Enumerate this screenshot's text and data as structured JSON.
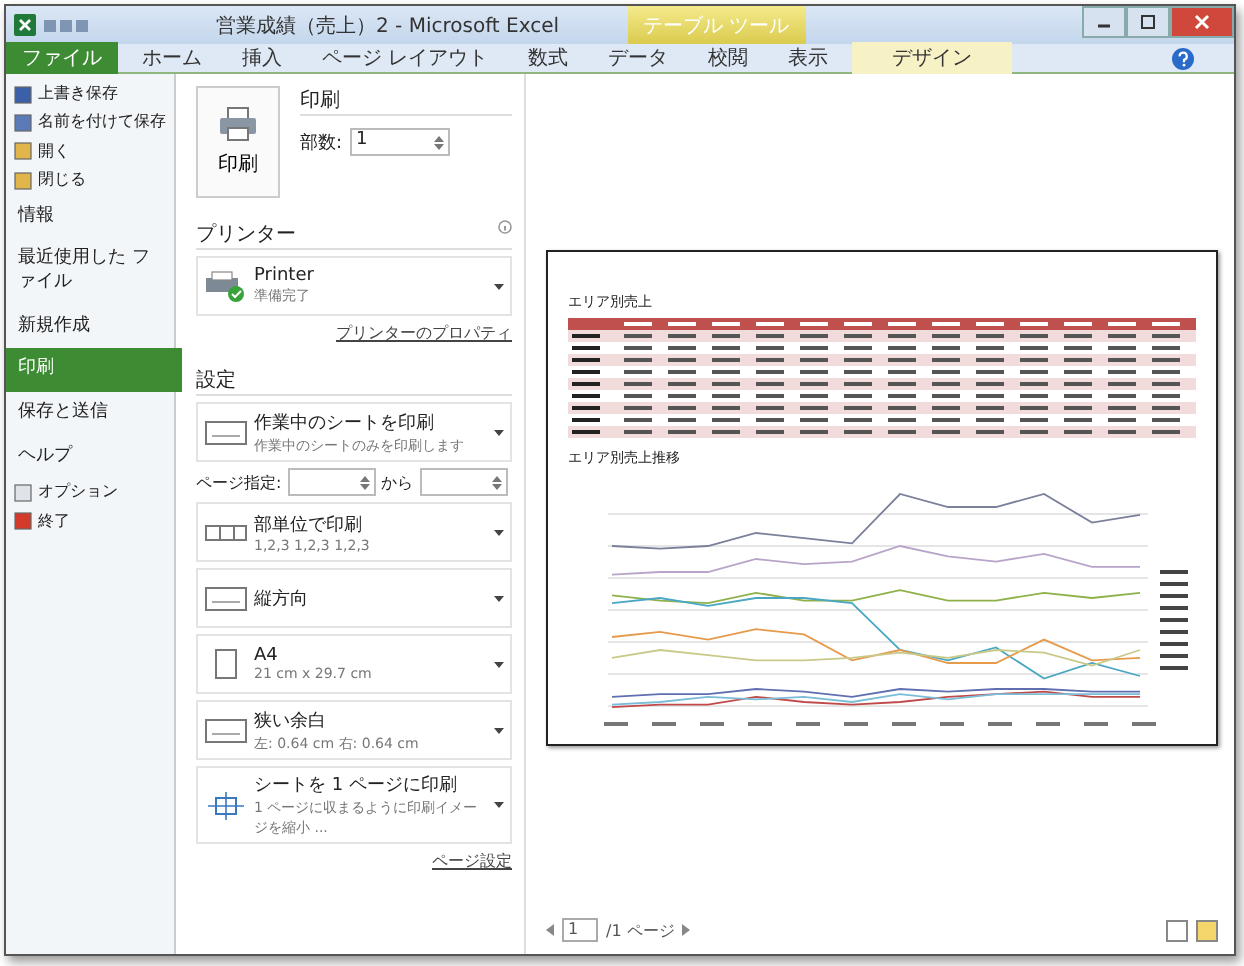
{
  "window": {
    "title": "営業成績（売上）2 - Microsoft Excel",
    "context_tab": "テーブル ツール"
  },
  "tabs": [
    {
      "label": "ファイル",
      "selected": true
    },
    {
      "label": "ホーム",
      "selected": false
    },
    {
      "label": "挿入",
      "selected": false
    },
    {
      "label": "ページ レイアウト",
      "selected": false
    },
    {
      "label": "数式",
      "selected": false
    },
    {
      "label": "データ",
      "selected": false
    },
    {
      "label": "校閲",
      "selected": false
    },
    {
      "label": "表示",
      "selected": false
    },
    {
      "label": "デザイン",
      "selected": false
    }
  ],
  "sidebar": {
    "items": [
      {
        "kind": "command",
        "label": "上書き保存",
        "selected": false
      },
      {
        "kind": "command",
        "label": "名前を付けて保存",
        "selected": false
      },
      {
        "kind": "command",
        "label": "開く",
        "selected": false
      },
      {
        "kind": "command",
        "label": "閉じる",
        "selected": false
      },
      {
        "kind": "section",
        "label": "情報",
        "selected": false
      },
      {
        "kind": "section",
        "label": "最近使用した ファイル",
        "selected": false
      },
      {
        "kind": "section",
        "label": "新規作成",
        "selected": false
      },
      {
        "kind": "section",
        "label": "印刷",
        "selected": true
      },
      {
        "kind": "section",
        "label": "保存と送信",
        "selected": false
      },
      {
        "kind": "section",
        "label": "ヘルプ",
        "selected": false
      },
      {
        "kind": "command",
        "label": "オプション",
        "selected": false
      },
      {
        "kind": "command",
        "label": "終了",
        "selected": false
      }
    ]
  },
  "print": {
    "button": "印刷",
    "heading": "印刷",
    "copies_label": "部数:",
    "copies": "1"
  },
  "printer": {
    "heading": "プリンター",
    "name": "Printer",
    "status": "準備完了",
    "properties_link": "プリンターのプロパティ"
  },
  "settings": {
    "heading": "設定",
    "options": [
      {
        "kind": "sheet",
        "title": "作業中のシートを印刷",
        "detail": "作業中のシートのみを印刷します"
      },
      {
        "kind": "pages",
        "from_label": "ページ指定:",
        "to_label": "から"
      },
      {
        "kind": "collate",
        "title": "部単位で印刷",
        "detail": "1,2,3    1,2,3    1,2,3"
      },
      {
        "kind": "orientation",
        "title": "縦方向"
      },
      {
        "kind": "paper",
        "title": "A4",
        "detail": "21 cm x 29.7 cm"
      },
      {
        "kind": "margins",
        "title": "狭い余白",
        "detail": "左: 0.64 cm   右: 0.64 cm"
      },
      {
        "kind": "scaling",
        "title": "シートを 1 ページに印刷",
        "detail": "1 ページに収まるように印刷イメージを縮小 ..."
      }
    ],
    "page_setup_link": "ページ設定"
  },
  "preview": {
    "table_title": "エリア別売上",
    "chart_title": "エリア別売上推移"
  },
  "pager": {
    "page": "1",
    "total": "/1 ページ"
  }
}
